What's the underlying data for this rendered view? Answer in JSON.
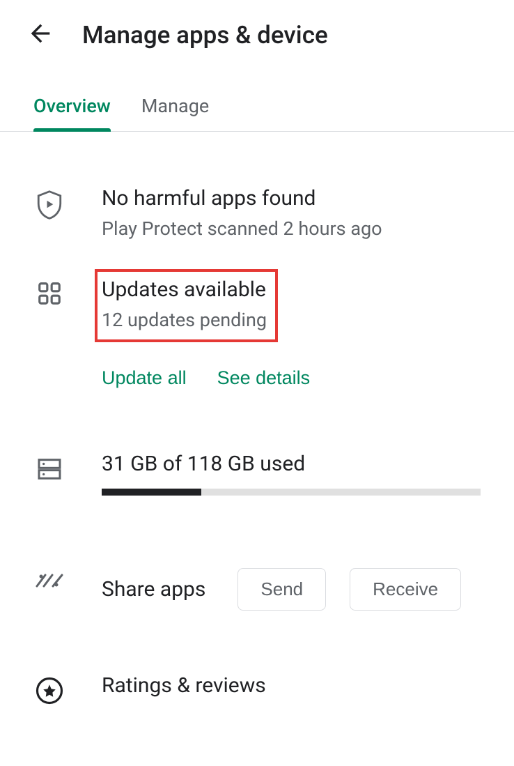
{
  "header": {
    "title": "Manage apps & device"
  },
  "tabs": {
    "overview": "Overview",
    "manage": "Manage"
  },
  "protect": {
    "title": "No harmful apps found",
    "subtitle": "Play Protect scanned 2 hours ago"
  },
  "updates": {
    "title": "Updates available",
    "subtitle": "12 updates pending",
    "update_all": "Update all",
    "see_details": "See details"
  },
  "storage": {
    "label": "31 GB of 118 GB used",
    "fill_percent": 26.3
  },
  "share": {
    "label": "Share apps",
    "send": "Send",
    "receive": "Receive"
  },
  "ratings": {
    "label": "Ratings & reviews"
  }
}
